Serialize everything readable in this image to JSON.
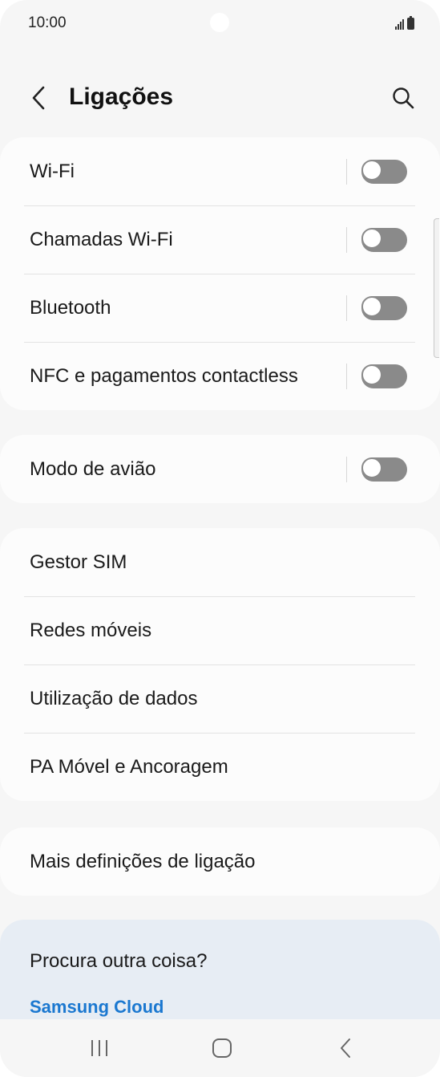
{
  "status_bar": {
    "time": "10:00"
  },
  "header": {
    "title": "Ligações",
    "back_icon": "chevron-left-icon",
    "search_icon": "search-icon"
  },
  "groups": [
    {
      "items": [
        {
          "label": "Wi-Fi",
          "toggle": true,
          "on": false
        },
        {
          "label": "Chamadas Wi-Fi",
          "toggle": true,
          "on": false
        },
        {
          "label": "Bluetooth",
          "toggle": true,
          "on": false
        },
        {
          "label": "NFC e pagamentos contactless",
          "toggle": true,
          "on": false
        }
      ]
    },
    {
      "items": [
        {
          "label": "Modo de avião",
          "toggle": true,
          "on": false
        }
      ]
    },
    {
      "items": [
        {
          "label": "Gestor SIM"
        },
        {
          "label": "Redes móveis"
        },
        {
          "label": "Utilização de dados"
        },
        {
          "label": "PA Móvel e Ancoragem"
        }
      ]
    },
    {
      "items": [
        {
          "label": "Mais definições de ligação"
        }
      ]
    }
  ],
  "suggestions": {
    "title": "Procura outra coisa?",
    "link": "Samsung Cloud"
  },
  "nav_bar": {
    "recents_icon": "recents-icon",
    "home_icon": "home-icon",
    "back_icon": "back-icon"
  },
  "colors": {
    "background": "#f6f6f6",
    "card": "#fcfcfc",
    "toggle_off": "#8a8a8a",
    "link": "#1b78d0",
    "suggestion_bg": "#e7edf4"
  }
}
